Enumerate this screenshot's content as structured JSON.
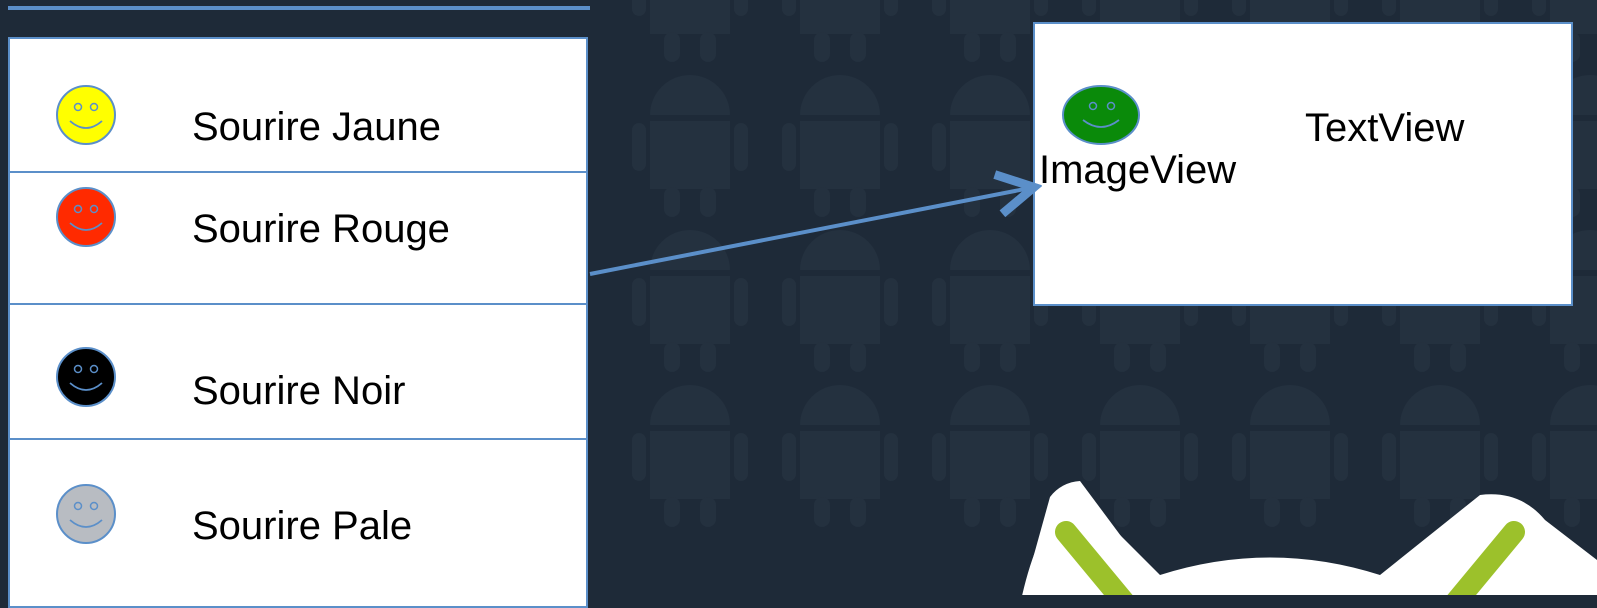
{
  "list": {
    "items": [
      {
        "label": "Sourire Jaune",
        "color": "#ffff00"
      },
      {
        "label": "Sourire Rouge",
        "color": "#ff2a00"
      },
      {
        "label": "Sourire Noir",
        "color": "#000000"
      },
      {
        "label": "Sourire Pale",
        "color": "#b8bcc2"
      }
    ]
  },
  "item_view": {
    "image_label": "ImageView",
    "text_label": "TextView",
    "icon_color": "#0a8a0a"
  },
  "colors": {
    "background": "#1e2a38",
    "accent": "#5b8fc9",
    "robot_green": "#9cc12b"
  }
}
